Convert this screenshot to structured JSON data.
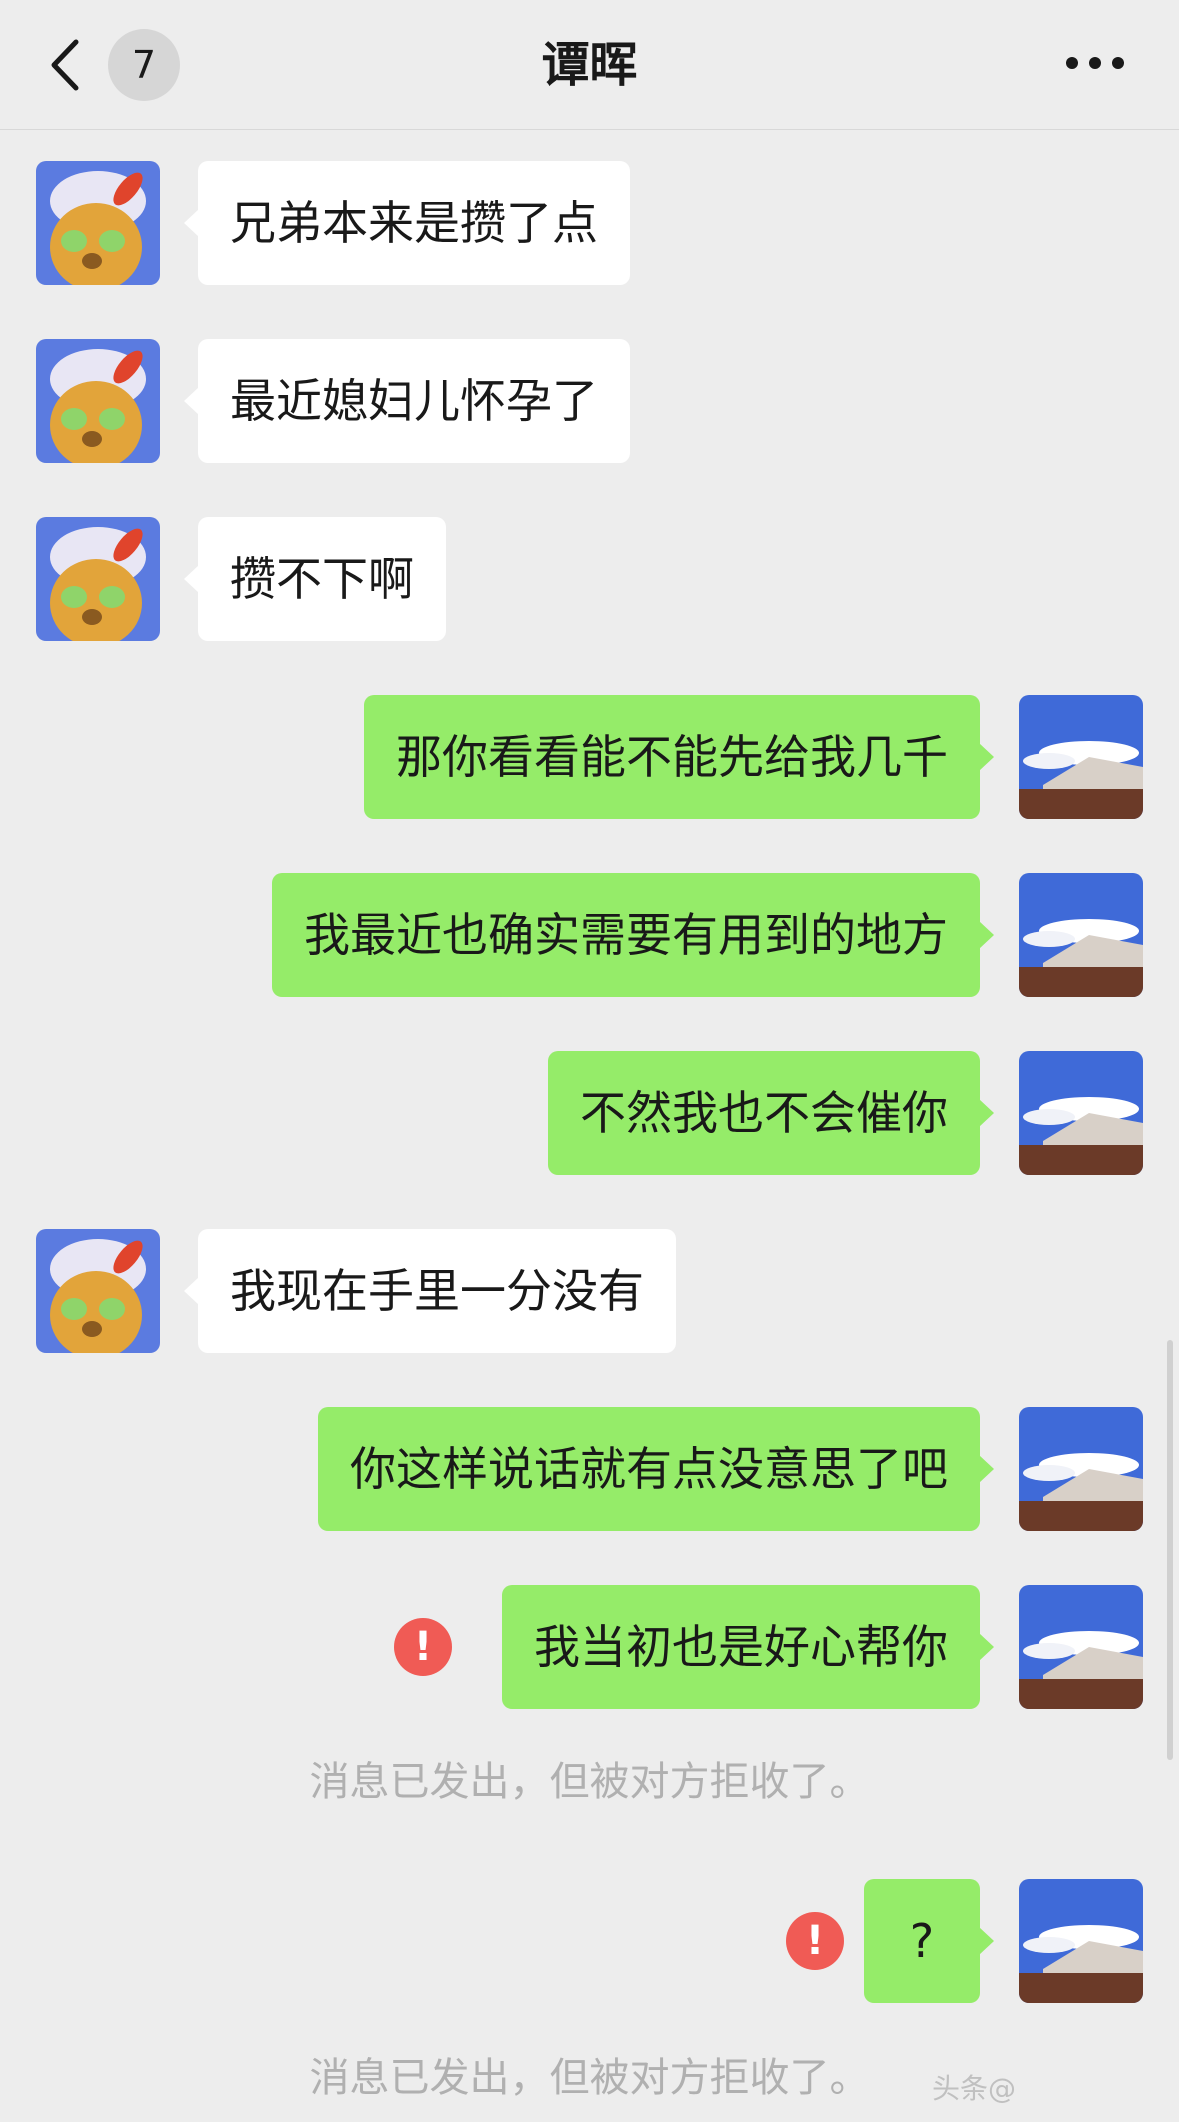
{
  "header": {
    "back_icon": "chevron-left-icon",
    "unread_count": "7",
    "title": "谭晖",
    "more_icon": "more-dots-icon"
  },
  "colors": {
    "background": "#ededed",
    "incoming_bubble": "#ffffff",
    "outgoing_bubble": "#95ec69",
    "error": "#f05b55",
    "system_text": "#b0b0b0"
  },
  "messages": [
    {
      "side": "in",
      "text": "兄弟本来是攒了点"
    },
    {
      "side": "in",
      "text": "最近媳妇儿怀孕了"
    },
    {
      "side": "in",
      "text": "攒不下啊"
    },
    {
      "side": "out",
      "text": "那你看看能不能先给我几千"
    },
    {
      "side": "out",
      "text": "我最近也确实需要有用到的地方"
    },
    {
      "side": "out",
      "text": "不然我也不会催你"
    },
    {
      "side": "in",
      "text": "我现在手里一分没有"
    },
    {
      "side": "out",
      "text": "你这样说话就有点没意思了吧"
    },
    {
      "side": "out",
      "text": "我当初也是好心帮你",
      "failed": true,
      "error_icon": "!"
    },
    {
      "side": "out",
      "text": "?",
      "failed": true,
      "error_icon": "!"
    }
  ],
  "system_notes": [
    "消息已发出，但被对方拒收了。",
    "消息已发出，但被对方拒收了。"
  ],
  "watermark": "头条@"
}
